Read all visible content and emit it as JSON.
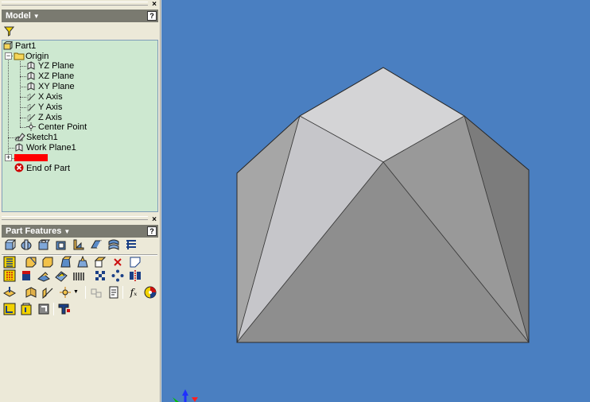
{
  "browser": {
    "title": "Model",
    "help": "?",
    "close": "×",
    "filter_icon": "funnel-icon",
    "tree": [
      {
        "label": "Part1",
        "icon": "part-icon"
      },
      {
        "label": "Origin",
        "icon": "folder-icon"
      },
      {
        "label": "YZ Plane",
        "icon": "plane-icon"
      },
      {
        "label": "XZ Plane",
        "icon": "plane-icon"
      },
      {
        "label": "XY Plane",
        "icon": "plane-icon"
      },
      {
        "label": "X Axis",
        "icon": "axis-icon"
      },
      {
        "label": "Y Axis",
        "icon": "axis-icon"
      },
      {
        "label": "Z Axis",
        "icon": "axis-icon"
      },
      {
        "label": "Center Point",
        "icon": "point-icon"
      },
      {
        "label": "Sketch1",
        "icon": "sketch-icon"
      },
      {
        "label": "Work Plane1",
        "icon": "workplane-icon"
      },
      {
        "label": "",
        "icon": "feature-icon"
      },
      {
        "label": "End of Part",
        "icon": "end-of-part-icon"
      }
    ]
  },
  "panel": {
    "title": "Part Features",
    "help": "?",
    "close": "×"
  },
  "colors": {
    "viewport_bg": "#4a7fc1",
    "tree_bg": "#cde8d0",
    "highlight": "#ff0000"
  }
}
